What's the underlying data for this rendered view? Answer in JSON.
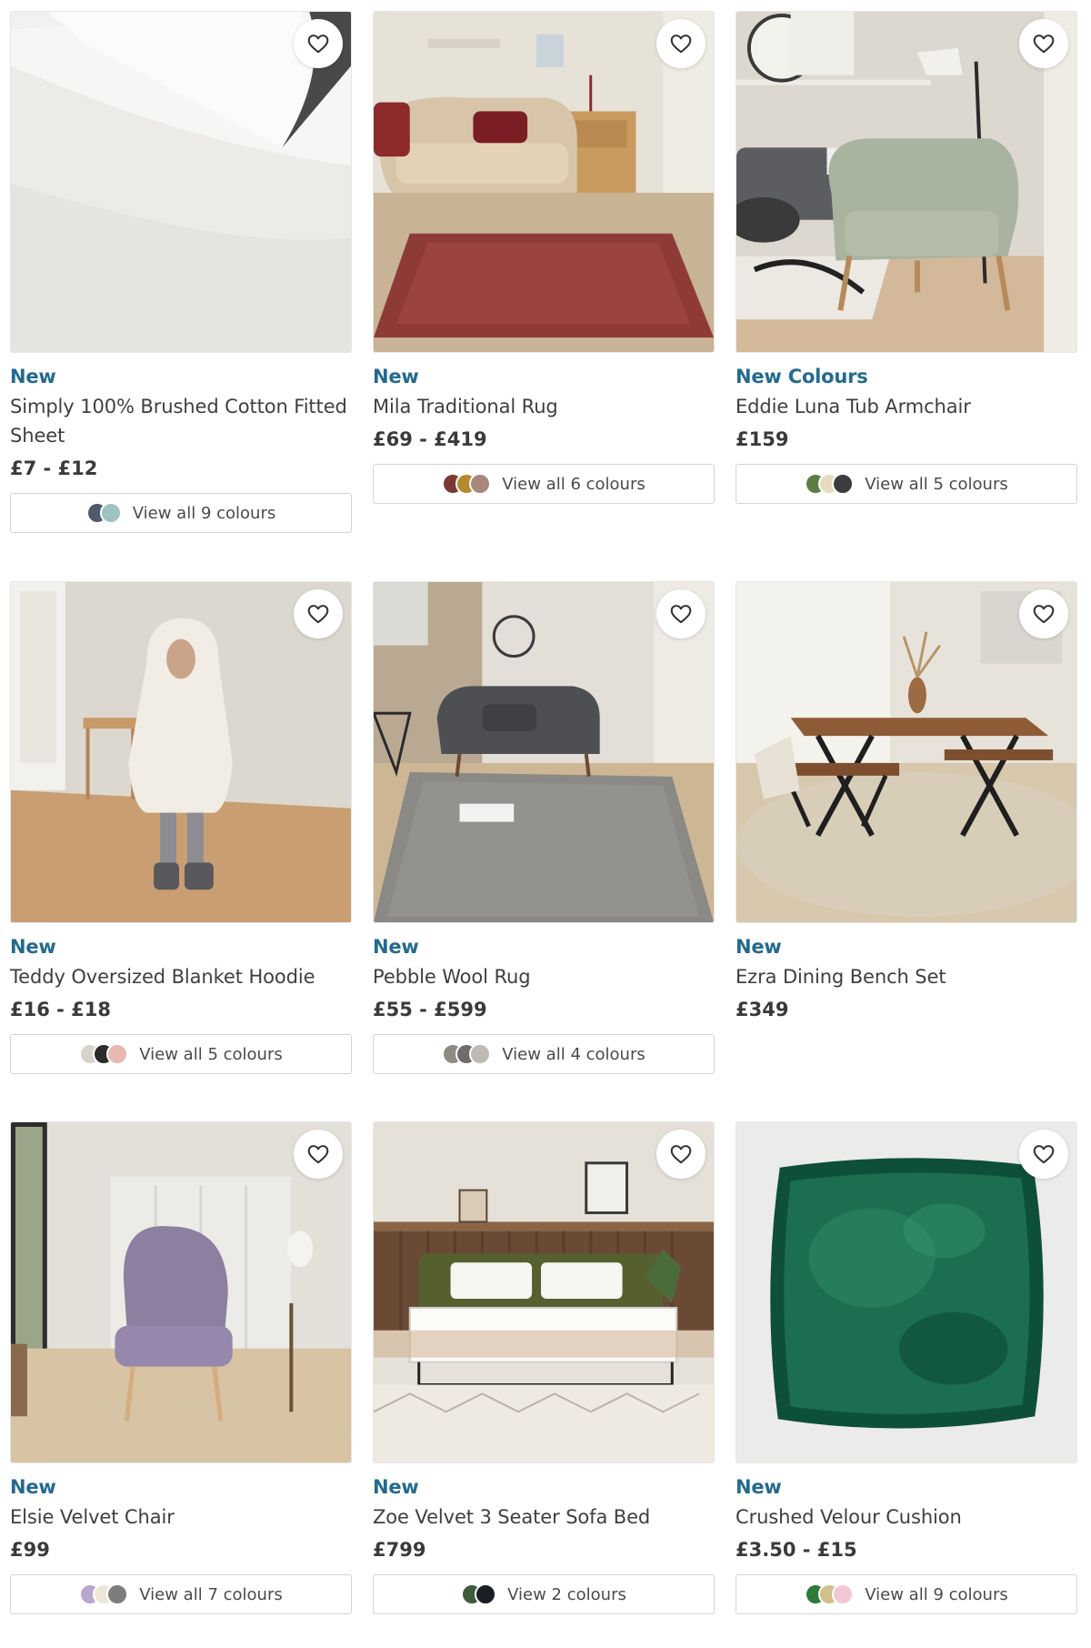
{
  "products": [
    {
      "badge": "New",
      "name": "Simply 100% Brushed Cotton Fitted Sheet",
      "price": "£7 - £12",
      "colours_label": "View all 9 colours",
      "swatches": [
        "#4f5b6b",
        "#9cc3be"
      ],
      "wishlist_icon": "heart-outline-icon"
    },
    {
      "badge": "New",
      "name": "Mila Traditional Rug",
      "price": "£69 - £419",
      "colours_label": "View all 6 colours",
      "swatches": [
        "#7a3a34",
        "#b58a2c",
        "#a8877a"
      ],
      "wishlist_icon": "heart-outline-icon"
    },
    {
      "badge": "New Colours",
      "name": "Eddie Luna Tub Armchair",
      "price": "£159",
      "colours_label": "View all 5 colours",
      "swatches": [
        "#5d7d44",
        "#e7dcc2",
        "#3c3c3c"
      ],
      "wishlist_icon": "heart-outline-icon"
    },
    {
      "badge": "New",
      "name": "Teddy Oversized Blanket Hoodie",
      "price": "£16 - £18",
      "colours_label": "View all 5 colours",
      "swatches": [
        "#d9d4cb",
        "#2b2b2b",
        "#e7b9b2"
      ],
      "wishlist_icon": "heart-outline-icon"
    },
    {
      "badge": "New",
      "name": "Pebble Wool Rug",
      "price": "£55 - £599",
      "colours_label": "View all 4 colours",
      "swatches": [
        "#8f8a84",
        "#6e6d6c",
        "#bdbab5"
      ],
      "wishlist_icon": "heart-outline-icon"
    },
    {
      "badge": "New",
      "name": "Ezra Dining Bench Set",
      "price": "£349",
      "colours_label": "",
      "swatches": [],
      "wishlist_icon": "heart-outline-icon"
    },
    {
      "badge": "New",
      "name": "Elsie Velvet Chair",
      "price": "£99",
      "colours_label": "View all 7 colours",
      "swatches": [
        "#b9a6cb",
        "#efe6da",
        "#7d7d7d"
      ],
      "wishlist_icon": "heart-outline-icon"
    },
    {
      "badge": "New",
      "name": "Zoe Velvet 3 Seater Sofa Bed",
      "price": "£799",
      "colours_label": "View 2 colours",
      "swatches": [
        "#3f5a3c",
        "#1b1f24"
      ],
      "wishlist_icon": "heart-outline-icon"
    },
    {
      "badge": "New",
      "name": "Crushed Velour Cushion",
      "price": "£3.50 - £15",
      "colours_label": "View all 9 colours",
      "swatches": [
        "#2e7a3a",
        "#d4c08a",
        "#f1c9d4"
      ],
      "wishlist_icon": "heart-outline-icon"
    }
  ],
  "colors": {
    "badge": "#246a8f",
    "text": "#3f3f3f",
    "button_border": "#cfd5dc"
  }
}
